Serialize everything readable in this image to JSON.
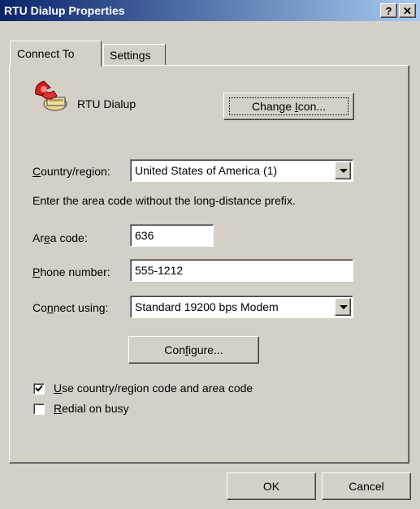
{
  "window": {
    "title": "RTU Dialup Properties",
    "help_button": "?",
    "close_button": "✕"
  },
  "tabs": [
    {
      "label": "Connect To",
      "selected": true
    },
    {
      "label": "Settings",
      "selected": false
    }
  ],
  "connection": {
    "icon": "phone-icon",
    "name": "RTU Dialup",
    "change_icon_button": {
      "pre": "Change ",
      "accel": "I",
      "post": "con..."
    }
  },
  "country": {
    "label": {
      "accel": "C",
      "post": "ountry/region:"
    },
    "value": "United States of America (1)"
  },
  "hint": "Enter the area code without the long-distance prefix.",
  "area_code": {
    "label": {
      "pre": "Ar",
      "accel": "e",
      "post": "a code:"
    },
    "value": "636"
  },
  "phone": {
    "label": {
      "accel": "P",
      "post": "hone number:"
    },
    "value": "555-1212"
  },
  "connect_using": {
    "label": {
      "pre": "Co",
      "accel": "n",
      "post": "nect using:"
    },
    "value": "Standard 19200 bps Modem"
  },
  "configure_button": {
    "pre": "Con",
    "accel": "f",
    "post": "igure..."
  },
  "checkboxes": [
    {
      "accel": "U",
      "post": "se country/region code and area code",
      "checked": true
    },
    {
      "accel": "R",
      "post": "edial on busy",
      "checked": false
    }
  ],
  "buttons": {
    "ok": "OK",
    "cancel": "Cancel"
  }
}
